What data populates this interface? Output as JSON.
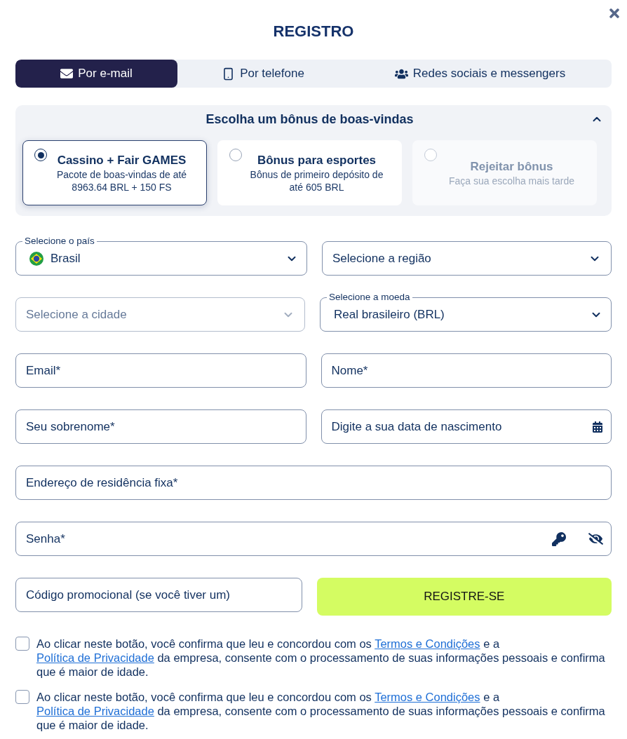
{
  "dialog": {
    "title": "REGISTRO"
  },
  "tabs": [
    {
      "label": "Por e-mail",
      "selected": true
    },
    {
      "label": "Por telefone",
      "selected": false
    },
    {
      "label": "Redes sociais e messengers",
      "selected": false
    }
  ],
  "bonus": {
    "heading": "Escolha um bônus de boas-vindas",
    "expanded": true,
    "options": [
      {
        "title": "Cassino + Fair GAMES",
        "description": "Pacote de boas-vindas de até 8963.64 BRL + 150 FS",
        "selected": true,
        "disabled": false
      },
      {
        "title": "Bônus para esportes",
        "description": "Bônus de primeiro depósito de até 605 BRL",
        "selected": false,
        "disabled": false
      },
      {
        "title": "Rejeitar bônus",
        "description": "Faça sua escolha mais tarde",
        "selected": false,
        "disabled": true
      }
    ]
  },
  "form": {
    "rows": [
      [
        {
          "kind": "country",
          "label": "Selecione o país",
          "value": "Brasil",
          "disabled": false
        },
        {
          "kind": "select",
          "placeholder": "Selecione a região",
          "disabled": false
        }
      ],
      [
        {
          "kind": "select",
          "placeholder": "Selecione a cidade",
          "disabled": true
        },
        {
          "kind": "select",
          "label": "Selecione a moeda",
          "value": "Real brasileiro (BRL)",
          "disabled": false
        }
      ],
      [
        {
          "kind": "text",
          "placeholder": "Email*",
          "disabled": false
        },
        {
          "kind": "text",
          "placeholder": "Nome*",
          "disabled": false
        }
      ],
      [
        {
          "kind": "text",
          "placeholder": "Seu sobrenome*",
          "disabled": false
        },
        {
          "kind": "date",
          "placeholder": "Digite a sua data de nascimento",
          "disabled": false
        }
      ],
      [
        {
          "kind": "text",
          "placeholder": "Endereço de residência fixa*",
          "disabled": false
        }
      ],
      [
        {
          "kind": "password",
          "placeholder": "Senha*",
          "visible": false,
          "disabled": false
        }
      ],
      [
        {
          "kind": "text",
          "placeholder": "Código promocional (se você tiver um)",
          "disabled": false
        },
        {
          "kind": "button",
          "label": "REGISTRE-SE",
          "disabled": false
        }
      ]
    ]
  },
  "agreements": [
    {
      "checked": false,
      "parts": [
        {
          "kind": "text",
          "text": "Ao clicar neste botão, você confirma que leu e concordou com os "
        },
        {
          "kind": "link",
          "text": "Termos e Condições"
        },
        {
          "kind": "text",
          "text": " e a "
        },
        {
          "kind": "link",
          "text": "Política de Privacidade"
        },
        {
          "kind": "text",
          "text": " da empresa, consente com o processamento de suas informações pessoais e confirma que é maior de idade."
        }
      ]
    },
    {
      "checked": false,
      "parts": [
        {
          "kind": "text",
          "text": "Ao clicar neste botão, você confirma que leu e concordou com os "
        },
        {
          "kind": "link",
          "text": "Termos e Condições"
        },
        {
          "kind": "text",
          "text": " e a "
        },
        {
          "kind": "link",
          "text": "Política de Privacidade"
        },
        {
          "kind": "text",
          "text": " da empresa, consente com o processamento de suas informações pessoais e confirma que é maior de idade."
        }
      ]
    }
  ]
}
